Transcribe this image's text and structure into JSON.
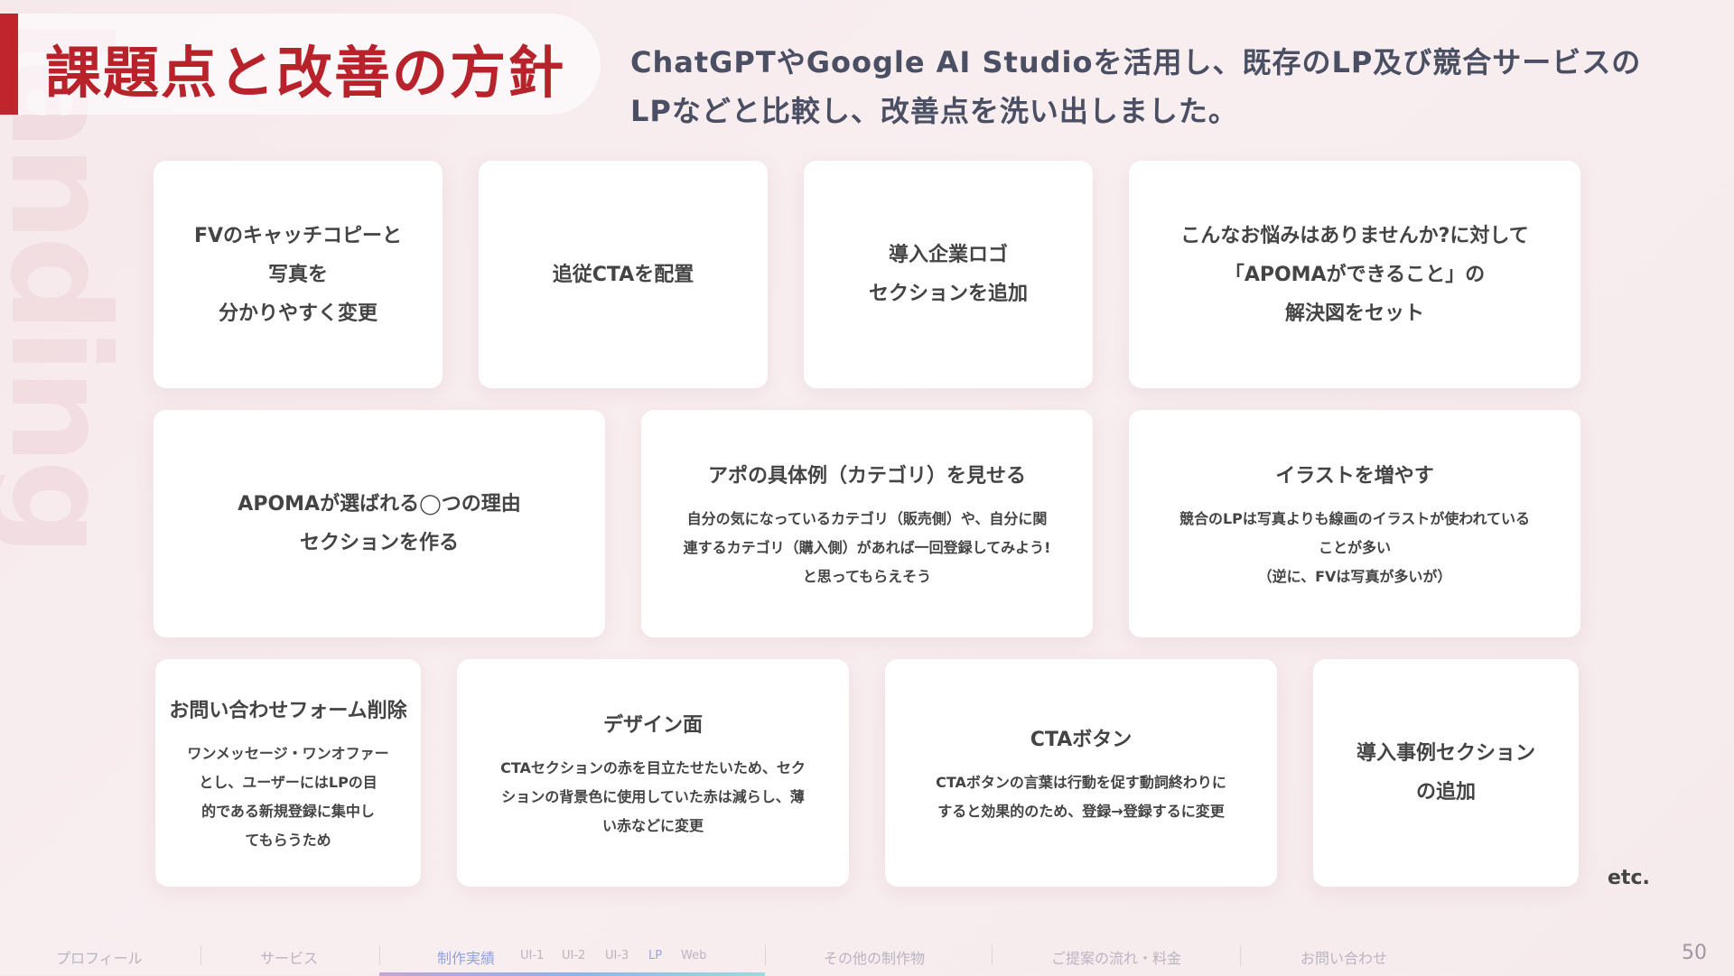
{
  "background_word": "landing page",
  "title": "課題点と改善の方針",
  "subtitle": "ChatGPTやGoogle AI Studioを活用し、既存のLP及び競合サービスのLPなどと比較し、改善点を洗い出しました。",
  "cards": [
    {
      "title": "FVのキャッチコピーと\n写真を\n分かりやすく変更",
      "desc": ""
    },
    {
      "title": "追従CTAを配置",
      "desc": ""
    },
    {
      "title": "導入企業ロゴ\nセクションを追加",
      "desc": ""
    },
    {
      "title": "こんなお悩みはありませんか?に対して\n「APOMAができること」の\n解決図をセット",
      "desc": ""
    },
    {
      "title": "APOMAが選ばれる◯つの理由\nセクションを作る",
      "desc": ""
    },
    {
      "title": "アポの具体例（カテゴリ）を見せる",
      "desc": "自分の気になっているカテゴリ（販売側）や、自分に関\n連するカテゴリ（購入側）があれば一回登録してみよう!\nと思ってもらえそう"
    },
    {
      "title": "イラストを増やす",
      "desc": "競合のLPは写真よりも線画のイラストが使われている\nことが多い\n（逆に、FVは写真が多いが）"
    },
    {
      "title": "お問い合わせフォーム削除",
      "desc": "ワンメッセージ・ワンオファー\nとし、ユーザーにはLPの目\n的である新規登録に集中し\nてもらうため"
    },
    {
      "title": "デザイン面",
      "desc": "CTAセクションの赤を目立たせたいため、セク\nションの背景色に使用していた赤は減らし、薄\nい赤などに変更"
    },
    {
      "title": "CTAボタン",
      "desc": "CTAボタンの言葉は行動を促す動詞終わりに\nすると効果的のため、登録→登録するに変更"
    },
    {
      "title": "導入事例セクション\nの追加",
      "desc": ""
    }
  ],
  "etc": "etc.",
  "nav": {
    "profile": "プロフィール",
    "service": "サービス",
    "works": "制作実績",
    "ui1": "UI-1",
    "ui2": "UI-2",
    "ui3": "UI-3",
    "lp": "LP",
    "web": "Web",
    "other": "その他の制作物",
    "flow": "ご提案の流れ・料金",
    "contact": "お問い合わせ"
  },
  "page_number": "50",
  "colors": {
    "accent": "#c0252b",
    "title": "#b8232b",
    "nav_active": "#8fa4df"
  }
}
